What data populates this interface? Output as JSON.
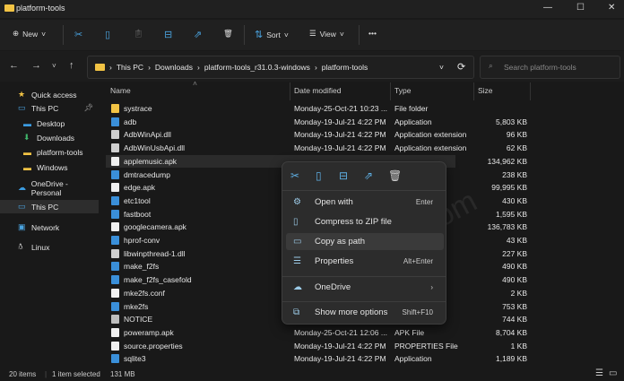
{
  "window": {
    "title": "platform-tools",
    "minimize": "—",
    "maximize": "☐",
    "close": "✕"
  },
  "toolbar": {
    "new": "New",
    "sort": "Sort",
    "view": "View",
    "more": "•••"
  },
  "address": {
    "crumbs": [
      "This PC",
      "Downloads",
      "platform-tools_r31.0.3-windows",
      "platform-tools"
    ],
    "search_placeholder": "Search platform-tools"
  },
  "sidebar": [
    {
      "label": "Quick access",
      "icon": "star-icon",
      "color": "#f2c344"
    },
    {
      "label": "This PC",
      "icon": "monitor-icon",
      "color": "#4aa3df",
      "pinned": true
    },
    {
      "label": "Desktop",
      "icon": "desktop-icon",
      "color": "#3b9be0"
    },
    {
      "label": "Downloads",
      "icon": "download-icon",
      "color": "#3fb56b"
    },
    {
      "label": "platform-tools",
      "icon": "folder-icon",
      "color": "#f2c344"
    },
    {
      "label": "Windows",
      "icon": "folder-icon",
      "color": "#f2c344"
    },
    {
      "label": "OneDrive - Personal",
      "icon": "cloud-icon",
      "color": "#3b9be0"
    },
    {
      "label": "This PC",
      "icon": "monitor-icon",
      "color": "#4aa3df",
      "selected": true
    },
    {
      "label": "Network",
      "icon": "network-icon",
      "color": "#4aa3df"
    },
    {
      "label": "Linux",
      "icon": "penguin-icon",
      "color": "#ddd"
    }
  ],
  "columns": {
    "name": "Name",
    "date": "Date modified",
    "type": "Type",
    "size": "Size"
  },
  "files": [
    {
      "name": "systrace",
      "date": "Monday-25-Oct-21 10:23 ...",
      "type": "File folder",
      "size": "",
      "kind": "folder"
    },
    {
      "name": "adb",
      "date": "Monday-19-Jul-21 4:22 PM",
      "type": "Application",
      "size": "5,803 KB",
      "kind": "app"
    },
    {
      "name": "AdbWinApi.dll",
      "date": "Monday-19-Jul-21 4:22 PM",
      "type": "Application extension",
      "size": "96 KB",
      "kind": "dll"
    },
    {
      "name": "AdbWinUsbApi.dll",
      "date": "Monday-19-Jul-21 4:22 PM",
      "type": "Application extension",
      "size": "62 KB",
      "kind": "dll"
    },
    {
      "name": "applemusic.apk",
      "date": "",
      "type": "",
      "size": "134,962 KB",
      "kind": "file",
      "selected": true
    },
    {
      "name": "dmtracedump",
      "date": "",
      "type": "",
      "size": "238 KB",
      "kind": "app"
    },
    {
      "name": "edge.apk",
      "date": "",
      "type": "",
      "size": "99,995 KB",
      "kind": "file"
    },
    {
      "name": "etc1tool",
      "date": "",
      "type": "",
      "size": "430 KB",
      "kind": "app"
    },
    {
      "name": "fastboot",
      "date": "",
      "type": "",
      "size": "1,595 KB",
      "kind": "app"
    },
    {
      "name": "googlecamera.apk",
      "date": "",
      "type": "",
      "size": "136,783 KB",
      "kind": "file"
    },
    {
      "name": "hprof-conv",
      "date": "",
      "type": "",
      "size": "43 KB",
      "kind": "app"
    },
    {
      "name": "libwinpthread-1.dll",
      "date": "",
      "type": "nsion",
      "size": "227 KB",
      "kind": "dll"
    },
    {
      "name": "make_f2fs",
      "date": "",
      "type": "",
      "size": "490 KB",
      "kind": "app"
    },
    {
      "name": "make_f2fs_casefold",
      "date": "",
      "type": "",
      "size": "490 KB",
      "kind": "app"
    },
    {
      "name": "mke2fs.conf",
      "date": "",
      "type": "",
      "size": "2 KB",
      "kind": "file"
    },
    {
      "name": "mke2fs",
      "date": "",
      "type": "",
      "size": "753 KB",
      "kind": "app"
    },
    {
      "name": "NOTICE",
      "date": "",
      "type": "",
      "size": "744 KB",
      "kind": "text"
    },
    {
      "name": "poweramp.apk",
      "date": "Monday-25-Oct-21 12:06 ...",
      "type": "APK File",
      "size": "8,704 KB",
      "kind": "file"
    },
    {
      "name": "source.properties",
      "date": "Monday-19-Jul-21 4:22 PM",
      "type": "PROPERTIES File",
      "size": "1 KB",
      "kind": "file"
    },
    {
      "name": "sqlite3",
      "date": "Monday-19-Jul-21 4:22 PM",
      "type": "Application",
      "size": "1,189 KB",
      "kind": "app"
    }
  ],
  "context_menu": {
    "items": [
      {
        "label": "Open with",
        "shortcut": "Enter",
        "icon": "open-with-icon"
      },
      {
        "label": "Compress to ZIP file",
        "shortcut": "",
        "icon": "zip-icon"
      },
      {
        "label": "Copy as path",
        "shortcut": "",
        "icon": "copy-path-icon",
        "hover": true
      },
      {
        "label": "Properties",
        "shortcut": "Alt+Enter",
        "icon": "properties-icon"
      },
      {
        "label": "OneDrive",
        "shortcut": "›",
        "icon": "onedrive-icon"
      },
      {
        "label": "Show more options",
        "shortcut": "Shift+F10",
        "icon": "more-options-icon"
      }
    ]
  },
  "status": {
    "items": "20 items",
    "selected": "1 item selected",
    "size": "131 MB"
  },
  "watermark": "geekermag.com"
}
